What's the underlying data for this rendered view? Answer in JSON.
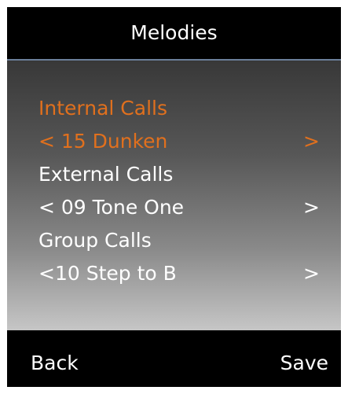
{
  "header": {
    "title": "Melodies"
  },
  "settings": [
    {
      "label": "Internal Calls",
      "value": "< 15 Dunken",
      "next_icon": ">"
    },
    {
      "label": "External Calls",
      "value": "< 09 Tone One",
      "next_icon": ">"
    },
    {
      "label": "Group Calls",
      "value": "<10 Step to B",
      "next_icon": ">"
    }
  ],
  "softkeys": {
    "left": "Back",
    "right": "Save"
  },
  "colors": {
    "selected": "#e0701e",
    "text": "#ffffff",
    "divider": "#6b7f9a",
    "background": "#000000"
  }
}
